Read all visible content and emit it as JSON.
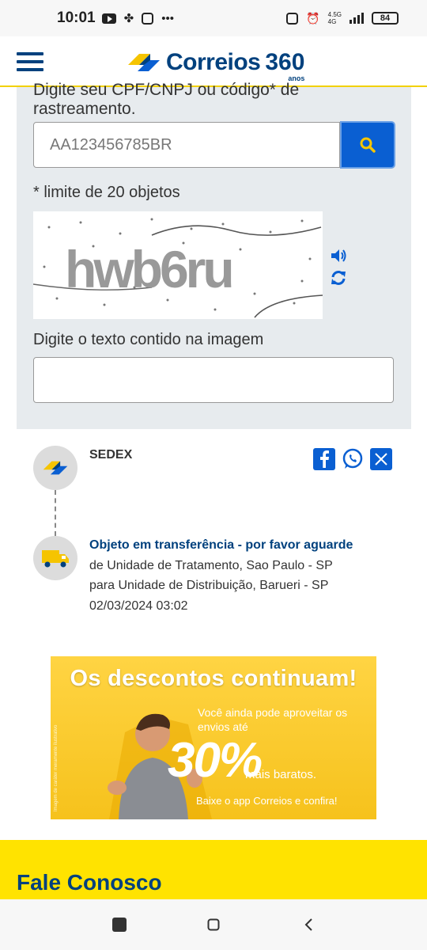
{
  "status_bar": {
    "time": "10:01",
    "network_label": "4.5G",
    "network_sub": "4G",
    "battery": "84"
  },
  "header": {
    "brand": "Correios",
    "anniversary": "360",
    "anniversary_sub": "anos"
  },
  "search": {
    "hint": "Digite seu CPF/CNPJ ou código* de rastreamento.",
    "input_value": "AA123456785BR",
    "limit_note": "* limite de 20 objetos",
    "captcha_text": "hwb6ru",
    "captcha_label": "Digite o texto contido na imagem",
    "captcha_input_value": ""
  },
  "tracking": {
    "carrier": "SEDEX",
    "event_title": "Objeto em transferência - por favor aguarde",
    "event_from": "de Unidade de Tratamento, Sao Paulo - SP",
    "event_to": "para Unidade de Distribuição, Barueri - SP",
    "event_datetime": "02/03/2024 03:02"
  },
  "banner": {
    "title": "Os descontos continuam!",
    "line1": "Você ainda pode aproveitar os envios até",
    "percent": "30%",
    "cheaper": "mais baratos.",
    "line3": "Baixe o app Correios e confira!",
    "side_note": "Imagem de caráter meramente ilustrativo"
  },
  "footer": {
    "title": "Fale Conosco"
  },
  "colors": {
    "brand_blue": "#00417e",
    "brand_yellow": "#ffe300",
    "search_button": "#0a5fd2",
    "panel_bg": "#e7ebee"
  }
}
